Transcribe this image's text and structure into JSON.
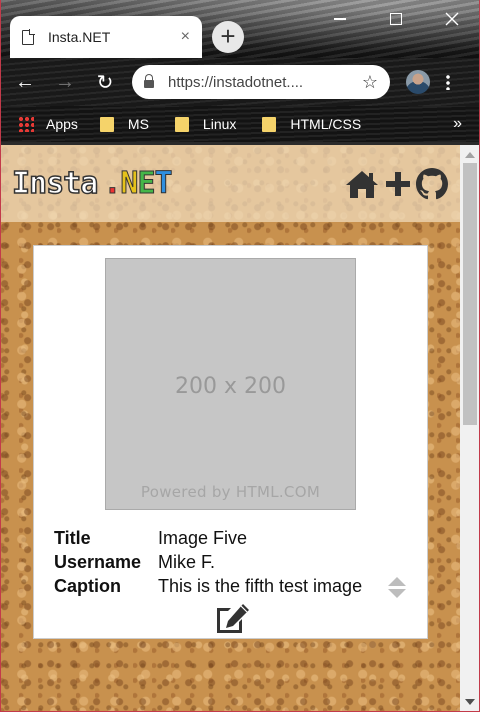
{
  "browser": {
    "tab_title": "Insta.NET",
    "tab_close": "×",
    "new_tab": "+",
    "url": "https://instadotnet....",
    "back": "←",
    "forward": "→",
    "reload": "↻",
    "star": "☆",
    "bookmarks": [
      {
        "label": "Apps",
        "icon": "apps-grid-icon"
      },
      {
        "label": "MS",
        "icon": "folder-icon"
      },
      {
        "label": "Linux",
        "icon": "folder-icon"
      },
      {
        "label": "HTML/CSS",
        "icon": "folder-icon"
      }
    ],
    "bookmarks_more": "»"
  },
  "site": {
    "brand_insta": "Insta",
    "brand_dot": ".",
    "brand_n": "N",
    "brand_e": "E",
    "brand_t": "T",
    "nav_icons": [
      "home-icon",
      "plus-icon",
      "github-icon"
    ]
  },
  "post": {
    "placeholder_size": "200 x 200",
    "placeholder_powered": "Powered by HTML.COM",
    "fields": [
      {
        "label": "Title",
        "value": "Image Five"
      },
      {
        "label": "Username",
        "value": "Mike F."
      },
      {
        "label": "Caption",
        "value": "This is the fifth test image"
      }
    ],
    "edit_icon": "edit-icon"
  },
  "colors": {
    "brand_dot": "#e33333",
    "brand_n": "#e5c21b",
    "brand_e": "#44b649",
    "brand_t": "#2f8fe0",
    "icon_dark": "#333333"
  }
}
